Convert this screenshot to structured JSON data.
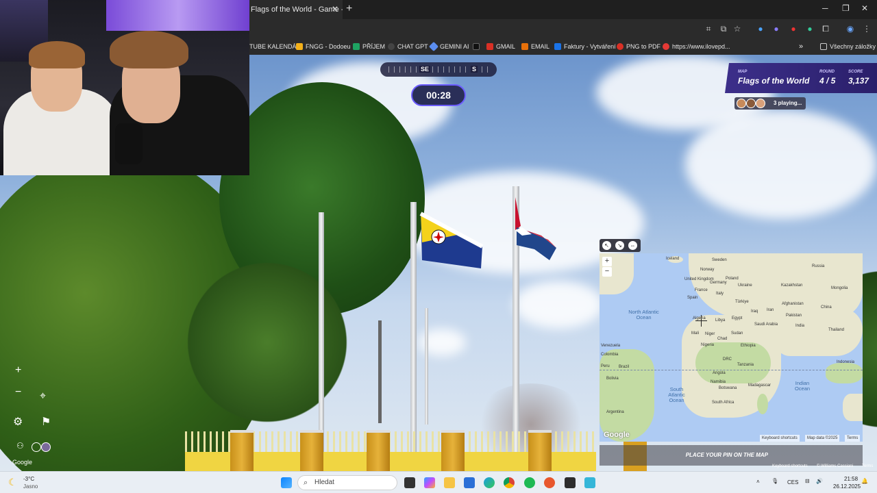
{
  "browser": {
    "tab_title": "Flags of the World - Game - Ge",
    "bookmarks": [
      {
        "label": "TUBE KALENDÁŘ",
        "color": "#c00"
      },
      {
        "label": "FNGG - Dodoeu",
        "color": "#f3b019"
      },
      {
        "label": "PŘÍJEM",
        "color": "#1ea362"
      },
      {
        "label": "CHAT GPT",
        "color": "#444"
      },
      {
        "label": "GEMINI AI",
        "color": "#5b8def"
      },
      {
        "label": "",
        "color": "#111"
      },
      {
        "label": "GMAIL",
        "color": "#d93025"
      },
      {
        "label": "EMAIL",
        "color": "#e8710a"
      },
      {
        "label": "Faktury - Vytváření",
        "color": "#1a73e8"
      },
      {
        "label": "PNG to PDF",
        "color": "#d93025"
      },
      {
        "label": "https://www.ilovepd...",
        "color": "#e53935"
      }
    ],
    "all_bookmarks": "Všechny záložky"
  },
  "game": {
    "compass": {
      "left": "SE",
      "right": "S"
    },
    "timer": "00:28",
    "map_label": "MAP",
    "map_name": "Flags of the World",
    "round_label": "ROUND",
    "round": "4 / 5",
    "score_label": "SCORE",
    "score": "3,137",
    "players": "3 playing...",
    "place_pin": "PLACE YOUR PIN ON THE MAP",
    "google": "Google"
  },
  "minimap": {
    "labels": [
      "Iceland",
      "Sweden",
      "Russia",
      "Norway",
      "United Kingdom",
      "Germany",
      "Poland",
      "Ukraine",
      "Kazakhstan",
      "Mongolia",
      "France",
      "Italy",
      "Spain",
      "Türkiye",
      "Iran",
      "Afghanistan",
      "China",
      "Iraq",
      "Pakistan",
      "Algeria",
      "Libya",
      "Egypt",
      "Saudi Arabia",
      "India",
      "Thailand",
      "Mali",
      "Niger",
      "Chad",
      "Sudan",
      "Ethiopia",
      "Nigeria",
      "DRC",
      "Tanzania",
      "Venezuela",
      "Colombia",
      "Brazil",
      "Peru",
      "Bolivia",
      "Angola",
      "Namibia",
      "Botswana",
      "Madagascar",
      "South Africa",
      "Argentina",
      "Indonesia"
    ],
    "oceans": {
      "north_atlantic": "North Atlantic Ocean",
      "south_atlantic": "South Atlantic Ocean",
      "indian": "Indian Ocean"
    },
    "google": "Google",
    "kbd": "Keyboard shortcuts",
    "mapdata": "Map data ©2025",
    "terms": "Terms"
  },
  "streetview_attrib": {
    "kbd": "Keyboard shortcuts",
    "author": "© Williams Cassiani",
    "terms": "Terms"
  },
  "taskbar": {
    "weather_temp": "-3°C",
    "weather_desc": "Jasno",
    "search": "Hledat",
    "lang": "CES",
    "time": "21:58",
    "date": "26.12.2025"
  }
}
